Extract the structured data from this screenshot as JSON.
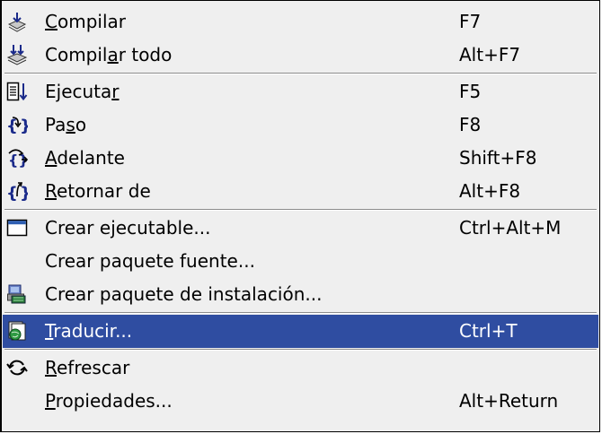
{
  "menu": {
    "items": [
      {
        "pre": "",
        "mn": "C",
        "post": "ompilar",
        "shortcut": "F7",
        "icon": "compile-icon"
      },
      {
        "pre": "Compil",
        "mn": "a",
        "post": "r todo",
        "shortcut": "Alt+F7",
        "icon": "compile-all-icon"
      },
      {
        "pre": "Ejecuta",
        "mn": "r",
        "post": "",
        "shortcut": "F5",
        "icon": "run-icon"
      },
      {
        "pre": "Pa",
        "mn": "s",
        "post": "o",
        "shortcut": "F8",
        "icon": "step-into-icon"
      },
      {
        "pre": "",
        "mn": "A",
        "post": "delante",
        "shortcut": "Shift+F8",
        "icon": "step-over-icon"
      },
      {
        "pre": "",
        "mn": "R",
        "post": "etornar de",
        "shortcut": "Alt+F8",
        "icon": "step-out-icon"
      },
      {
        "pre": "Crear e",
        "mn": "j",
        "post": "ecutable...",
        "shortcut": "Ctrl+Alt+M",
        "icon": "window-icon"
      },
      {
        "pre": "Crear paquete fuente...",
        "mn": "",
        "post": "",
        "shortcut": "",
        "icon": ""
      },
      {
        "pre": "Crear paquete de instalación...",
        "mn": "",
        "post": "",
        "shortcut": "",
        "icon": "installer-icon"
      },
      {
        "pre": "",
        "mn": "T",
        "post": "raducir...",
        "shortcut": "Ctrl+T",
        "icon": "translate-icon"
      },
      {
        "pre": "",
        "mn": "R",
        "post": "efrescar",
        "shortcut": "",
        "icon": "refresh-icon"
      },
      {
        "pre": "",
        "mn": "P",
        "post": "ropiedades...",
        "shortcut": "Alt+Return",
        "icon": ""
      }
    ],
    "selected_index": 9,
    "colors": {
      "selection": "#2f4da1",
      "background": "#efefef"
    }
  }
}
